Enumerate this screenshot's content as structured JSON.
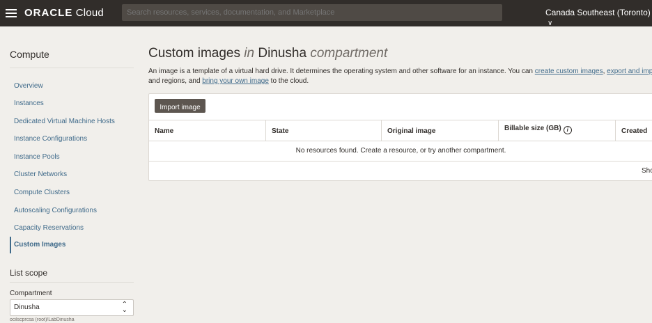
{
  "header": {
    "logo_brand": "ORACLE",
    "logo_product": "Cloud",
    "search_placeholder": "Search resources, services, documentation, and Marketplace",
    "region": "Canada Southeast (Toronto)"
  },
  "sidebar": {
    "title": "Compute",
    "items": [
      {
        "label": "Overview"
      },
      {
        "label": "Instances"
      },
      {
        "label": "Dedicated Virtual Machine Hosts"
      },
      {
        "label": "Instance Configurations"
      },
      {
        "label": "Instance Pools"
      },
      {
        "label": "Cluster Networks"
      },
      {
        "label": "Compute Clusters"
      },
      {
        "label": "Autoscaling Configurations"
      },
      {
        "label": "Capacity Reservations"
      },
      {
        "label": "Custom Images",
        "active": true
      }
    ],
    "scope_title": "List scope",
    "compartment_label": "Compartment",
    "compartment_value": "Dinusha",
    "compartment_path": "ocilscprcsa (root)/LabDinusha"
  },
  "main": {
    "title_prefix": "Custom images",
    "title_in": "in",
    "title_compartment": "Dinusha",
    "title_suffix": "compartment",
    "desc_line1_text": "An image is a template of a virtual hard drive. It determines the operating system and other software for an instance. You can ",
    "desc_link1": "create custom images",
    "desc_comma": ", ",
    "desc_link2": "export and impo",
    "desc_line2_text": "and regions, and ",
    "desc_link3": "bring your own image",
    "desc_line2_end": " to the cloud.",
    "import_button": "Import image",
    "columns": [
      "Name",
      "State",
      "Original image",
      "Billable size (GB)",
      "Created"
    ],
    "empty_message": "No resources found. Create a resource, or try another compartment.",
    "footer_text": "Sho"
  },
  "icons": {
    "menu": "hamburger-icon",
    "region_chevron": "chevron-down-icon",
    "info": "info-icon",
    "select_arrows": "updown-chevron-icon"
  }
}
